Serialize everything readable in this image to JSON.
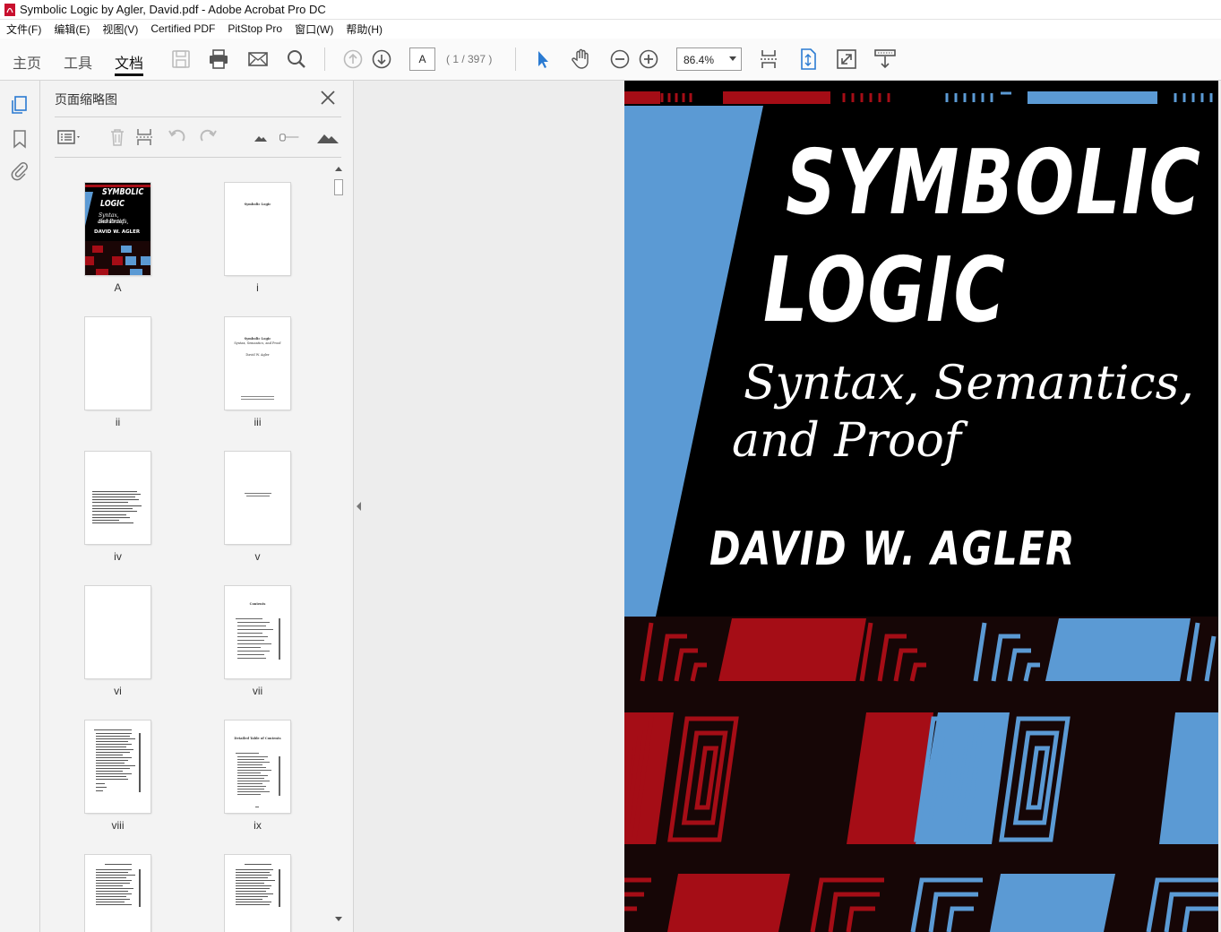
{
  "window": {
    "title": "Symbolic Logic by Agler, David.pdf - Adobe Acrobat Pro DC"
  },
  "menu": [
    "文件(F)",
    "编辑(E)",
    "视图(V)",
    "Certified PDF",
    "PitStop Pro",
    "窗口(W)",
    "帮助(H)"
  ],
  "toolbar": {
    "tabs": [
      "主页",
      "工具",
      "文档"
    ],
    "active_tab": "文档",
    "page_label": "A",
    "page_count": "( 1 / 397 )",
    "zoom": "86.4%"
  },
  "panel": {
    "title": "页面缩略图",
    "thumbnails": [
      {
        "label": "A",
        "kind": "cover"
      },
      {
        "label": "i",
        "kind": "halftitle"
      },
      {
        "label": "ii",
        "kind": "blank"
      },
      {
        "label": "iii",
        "kind": "titlepage"
      },
      {
        "label": "iv",
        "kind": "copyright"
      },
      {
        "label": "v",
        "kind": "dedication"
      },
      {
        "label": "vi",
        "kind": "blank"
      },
      {
        "label": "vii",
        "kind": "contents"
      },
      {
        "label": "viii",
        "kind": "contents"
      },
      {
        "label": "ix",
        "kind": "detailed"
      },
      {
        "label": "",
        "kind": "contents"
      },
      {
        "label": "",
        "kind": "contents"
      }
    ],
    "mini_cover": {
      "title1": "SYMBOLIC",
      "title2": "LOGIC",
      "sub1": "Syntax, Semantics,",
      "sub2": "and Proof",
      "author": "DAVID W. AGLER"
    },
    "halftitle_text": "Symbolic Logic",
    "titlepage_lines": [
      "Symbolic Logic",
      "Syntax, Semantics, and Proof",
      "David W. Agler"
    ],
    "contents_heading": "Contents",
    "detailed_heading": "Detailed Table of Contents"
  },
  "cover": {
    "title_line1": "SYMBOLIC",
    "title_line2": "LOGIC",
    "subtitle_line1": "Syntax, Semantics,",
    "subtitle_line2": "and Proof",
    "author": "DAVID W. AGLER",
    "colors": {
      "background": "#000000",
      "red": "#a50d16",
      "blue": "#5b9ad4"
    }
  }
}
